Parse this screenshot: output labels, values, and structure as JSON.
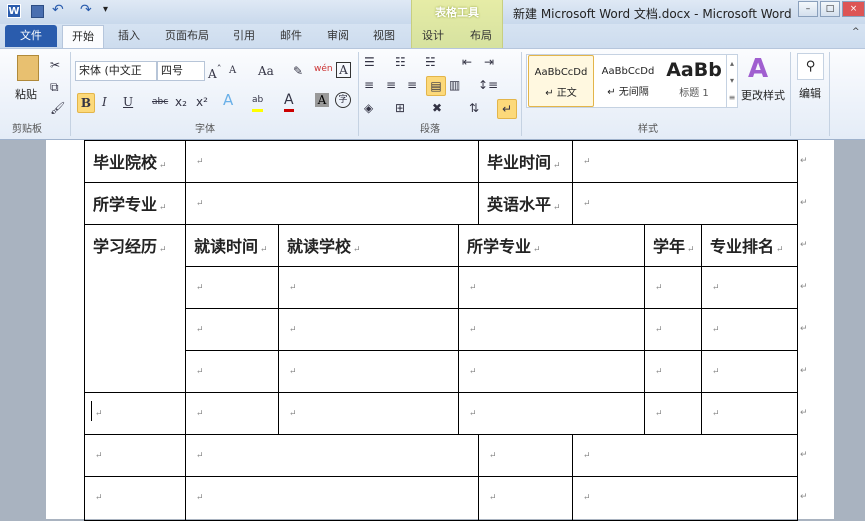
{
  "window": {
    "title": "新建 Microsoft Word 文档.docx - Microsoft Word",
    "context_tab": "表格工具"
  },
  "quick_access": {
    "word_icon": "W",
    "customize": "▾"
  },
  "tabs": {
    "file": "文件",
    "home": "开始",
    "items": [
      "插入",
      "页面布局",
      "引用",
      "邮件",
      "审阅",
      "视图"
    ],
    "design": "设计",
    "layout": "布局"
  },
  "ribbon": {
    "clipboard": {
      "paste": "粘贴",
      "group": "剪贴板"
    },
    "font": {
      "font_name": "宋体 (中文正 ",
      "font_size": "四号",
      "case": "Aa",
      "group": "字体",
      "bold": "B",
      "italic": "I",
      "underline": "U",
      "strike": "abc",
      "sub": "x₂",
      "sup": "x²",
      "char_border": "A",
      "phonetic": "wén",
      "enclose": "字",
      "shade": "A",
      "color": "A",
      "highlight": "ab"
    },
    "paragraph": {
      "group": "段落"
    },
    "styles": {
      "items": [
        {
          "preview": "AaBbCcDd",
          "name": "↵ 正文"
        },
        {
          "preview": "AaBbCcDd",
          "name": "↵ 无间隔"
        },
        {
          "preview": "AaBb",
          "name": "标题 1"
        }
      ],
      "change": "更改样式",
      "group": "样式"
    },
    "editing": {
      "label": "编辑"
    }
  },
  "table": {
    "row1": {
      "label1": "毕业院校",
      "label2": "毕业时间"
    },
    "row2": {
      "label1": "所学专业",
      "label2": "英语水平"
    },
    "education": {
      "label": "学习经历",
      "headers": [
        "就读时间",
        "就读学校",
        "所学专业",
        "学年",
        "专业排名"
      ]
    },
    "mark": "↵"
  },
  "colors": {
    "file_tab": "#2a5cad",
    "context": "#d6e2a0",
    "selected": "#fcd97a"
  }
}
